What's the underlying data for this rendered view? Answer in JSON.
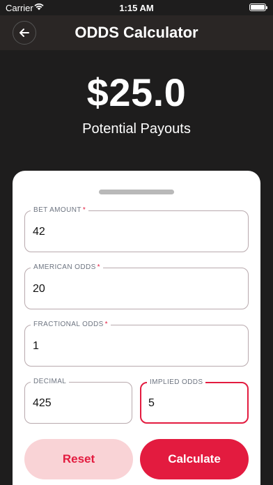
{
  "status_bar": {
    "carrier": "Carrier",
    "time": "1:15 AM"
  },
  "nav": {
    "title": "ODDS Calculator",
    "back_icon": "arrow-left-icon"
  },
  "summary": {
    "amount": "$25.0",
    "label": "Potential Payouts"
  },
  "form": {
    "bet_amount": {
      "label": "BET AMOUNT",
      "required": "*",
      "value": "42"
    },
    "american_odds": {
      "label": "AMERICAN ODDS",
      "required": "*",
      "value": "20"
    },
    "fractional_odds": {
      "label": "FRACTIONAL ODDS",
      "required": "*",
      "value": "1"
    },
    "decimal": {
      "label": "DECIMAL",
      "value": "425"
    },
    "implied_odds": {
      "label": "IMPLIED ODDS",
      "value": "5"
    }
  },
  "buttons": {
    "reset": "Reset",
    "calculate": "Calculate"
  },
  "colors": {
    "accent": "#e31b3f",
    "accent_light": "#f9d3d6",
    "background": "#1e1d1d"
  }
}
